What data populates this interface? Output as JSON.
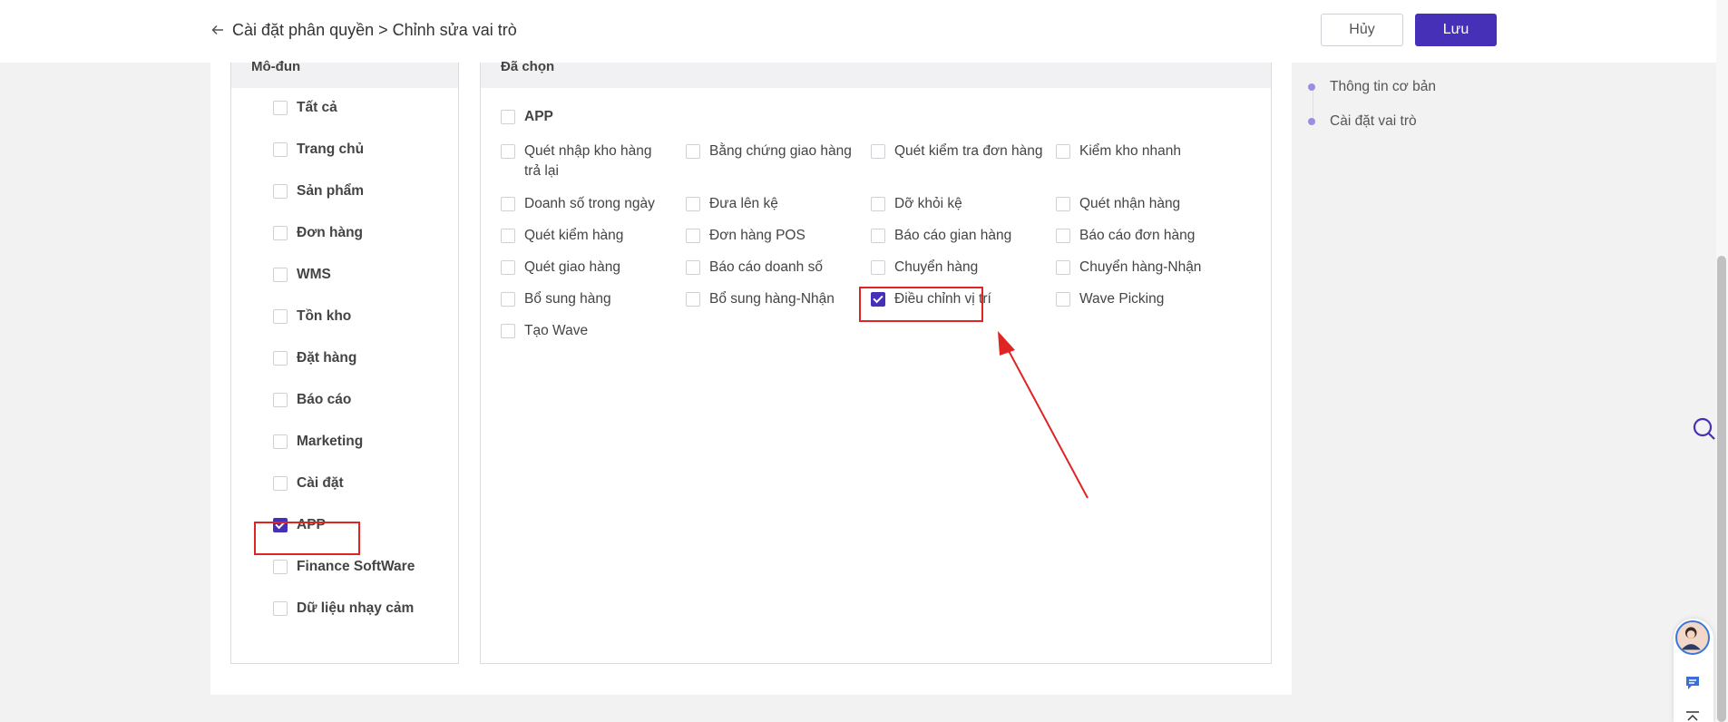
{
  "header": {
    "breadcrumb": "Cài đặt phân quyền > Chỉnh sửa vai trò",
    "cancel_label": "Hủy",
    "save_label": "Lưu"
  },
  "modules": {
    "title": "Mô-đun",
    "items": [
      {
        "label": "Tất cả",
        "checked": false
      },
      {
        "label": "Trang chủ",
        "checked": false
      },
      {
        "label": "Sản phẩm",
        "checked": false
      },
      {
        "label": "Đơn hàng",
        "checked": false
      },
      {
        "label": "WMS",
        "checked": false
      },
      {
        "label": "Tồn kho",
        "checked": false
      },
      {
        "label": "Đặt hàng",
        "checked": false
      },
      {
        "label": "Báo cáo",
        "checked": false
      },
      {
        "label": "Marketing",
        "checked": false
      },
      {
        "label": "Cài đặt",
        "checked": false
      },
      {
        "label": "APP",
        "checked": true
      },
      {
        "label": "Finance SoftWare",
        "checked": false
      },
      {
        "label": "Dữ liệu nhạy cảm",
        "checked": false
      }
    ]
  },
  "selected": {
    "title": "Đã chọn",
    "group_label": "APP",
    "items": [
      {
        "label": "Quét nhập kho hàng trả lại",
        "checked": false
      },
      {
        "label": "Bằng chứng giao hàng",
        "checked": false
      },
      {
        "label": "Quét kiểm tra đơn hàng",
        "checked": false
      },
      {
        "label": "Kiểm kho nhanh",
        "checked": false
      },
      {
        "label": "Doanh số trong ngày",
        "checked": false
      },
      {
        "label": "Đưa lên kệ",
        "checked": false
      },
      {
        "label": "Dỡ khỏi kệ",
        "checked": false
      },
      {
        "label": "Quét nhận hàng",
        "checked": false
      },
      {
        "label": "Quét kiểm hàng",
        "checked": false
      },
      {
        "label": "Đơn hàng POS",
        "checked": false
      },
      {
        "label": "Báo cáo gian hàng",
        "checked": false
      },
      {
        "label": "Báo cáo đơn hàng",
        "checked": false
      },
      {
        "label": "Quét giao hàng",
        "checked": false
      },
      {
        "label": "Báo cáo doanh số",
        "checked": false
      },
      {
        "label": "Chuyển hàng",
        "checked": false
      },
      {
        "label": "Chuyển hàng-Nhận",
        "checked": false
      },
      {
        "label": "Bổ sung hàng",
        "checked": false
      },
      {
        "label": "Bổ sung hàng-Nhận",
        "checked": false
      },
      {
        "label": "Điều chỉnh vị trí",
        "checked": true
      },
      {
        "label": "Wave Picking",
        "checked": false
      },
      {
        "label": "Tạo Wave",
        "checked": false
      }
    ]
  },
  "side_nav": {
    "items": [
      "Thông tin cơ bản",
      "Cài đặt vai trò"
    ]
  },
  "colors": {
    "accent": "#4530b7",
    "annotation": "#e02424"
  }
}
